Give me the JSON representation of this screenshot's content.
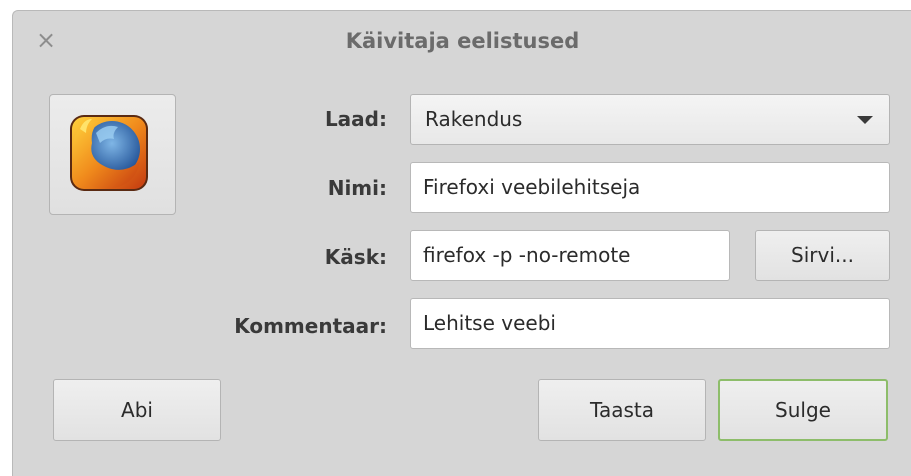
{
  "window": {
    "title": "Käivitaja eelistused",
    "close_glyph": "×"
  },
  "icon": {
    "name": "firefox-icon"
  },
  "form": {
    "type_label": "Laad:",
    "type_value": "Rakendus",
    "name_label": "Nimi:",
    "name_value": "Firefoxi veebilehitseja",
    "command_label": "Käsk:",
    "command_value": "firefox -p -no-remote",
    "browse_label": "Sirvi...",
    "comment_label": "Kommentaar:",
    "comment_value": "Lehitse veebi"
  },
  "buttons": {
    "help": "Abi",
    "revert": "Taasta",
    "close": "Sulge"
  },
  "colors": {
    "dialog_bg": "#d6d6d6",
    "default_button_border": "#8dbd6a"
  }
}
